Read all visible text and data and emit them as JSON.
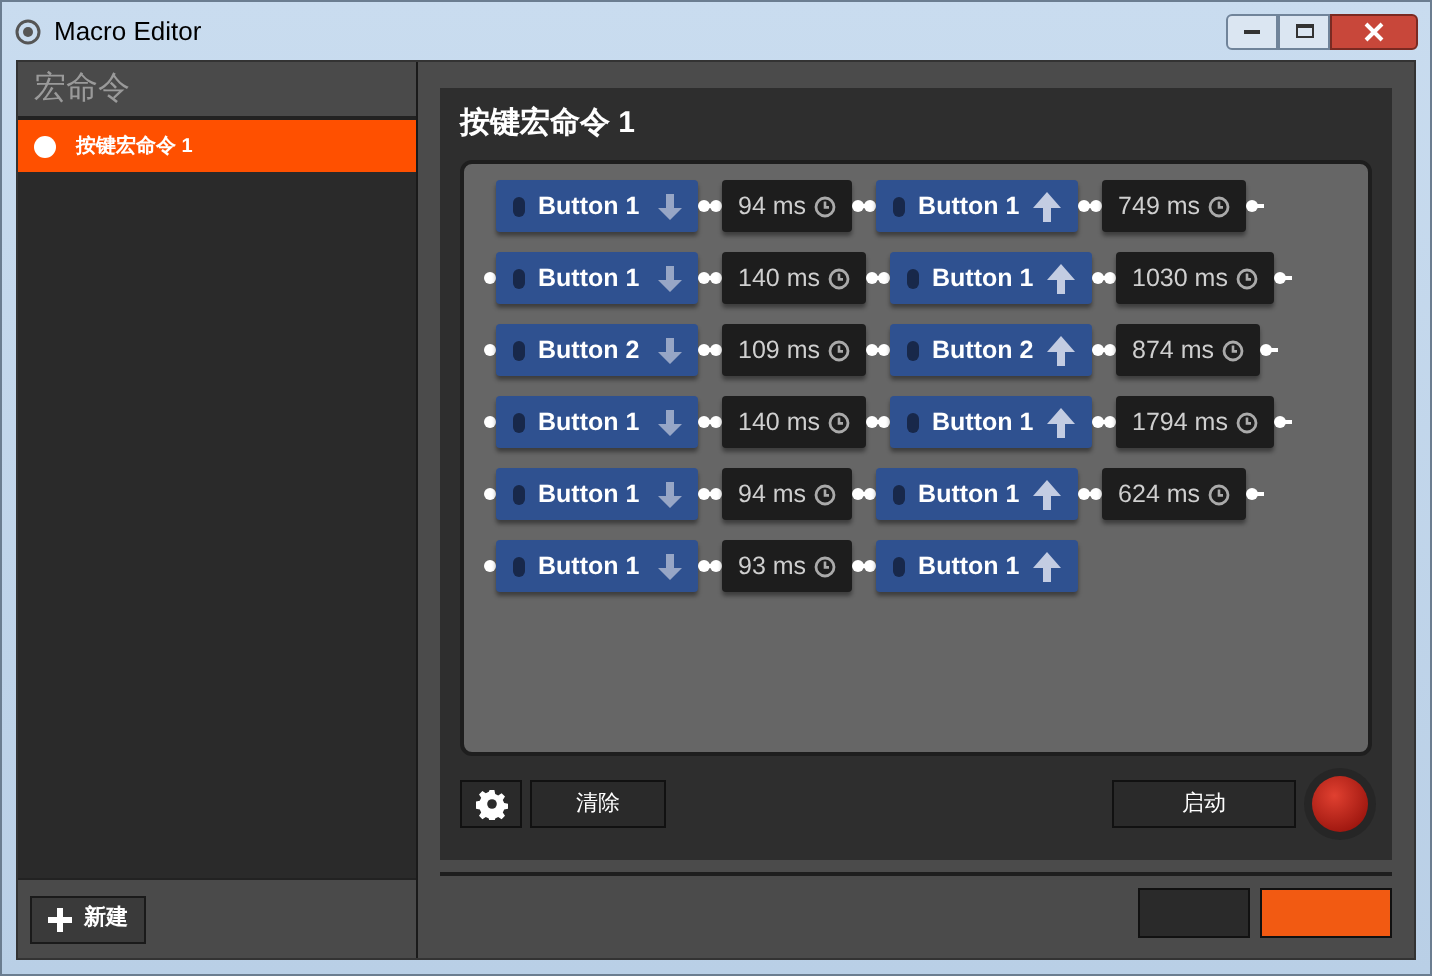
{
  "window": {
    "title": "Macro Editor"
  },
  "sidebar": {
    "header": "宏命令",
    "items": [
      {
        "label": "按键宏命令 1",
        "selected": true
      }
    ],
    "new_button": "新建"
  },
  "editor": {
    "title": "按键宏命令 1",
    "rows": [
      [
        {
          "kind": "key",
          "label": "Button 1",
          "pressed": true
        },
        {
          "kind": "delay",
          "text": "94 ms"
        },
        {
          "kind": "key",
          "label": "Button 1",
          "pressed": false
        },
        {
          "kind": "delay",
          "text": "749 ms"
        }
      ],
      [
        {
          "kind": "key",
          "label": "Button 1",
          "pressed": true
        },
        {
          "kind": "delay",
          "text": "140 ms"
        },
        {
          "kind": "key",
          "label": "Button 1",
          "pressed": false
        },
        {
          "kind": "delay",
          "text": "1030 ms"
        }
      ],
      [
        {
          "kind": "key",
          "label": "Button 2",
          "pressed": true
        },
        {
          "kind": "delay",
          "text": "109 ms"
        },
        {
          "kind": "key",
          "label": "Button 2",
          "pressed": false
        },
        {
          "kind": "delay",
          "text": "874 ms"
        }
      ],
      [
        {
          "kind": "key",
          "label": "Button 1",
          "pressed": true
        },
        {
          "kind": "delay",
          "text": "140 ms"
        },
        {
          "kind": "key",
          "label": "Button 1",
          "pressed": false
        },
        {
          "kind": "delay",
          "text": "1794 ms"
        }
      ],
      [
        {
          "kind": "key",
          "label": "Button 1",
          "pressed": true
        },
        {
          "kind": "delay",
          "text": "94 ms"
        },
        {
          "kind": "key",
          "label": "Button 1",
          "pressed": false
        },
        {
          "kind": "delay",
          "text": "624 ms"
        }
      ],
      [
        {
          "kind": "key",
          "label": "Button 1",
          "pressed": true
        },
        {
          "kind": "delay",
          "text": "93 ms"
        },
        {
          "kind": "key",
          "label": "Button 1",
          "pressed": false
        }
      ]
    ],
    "clear_button": "清除",
    "start_button": "启动"
  }
}
